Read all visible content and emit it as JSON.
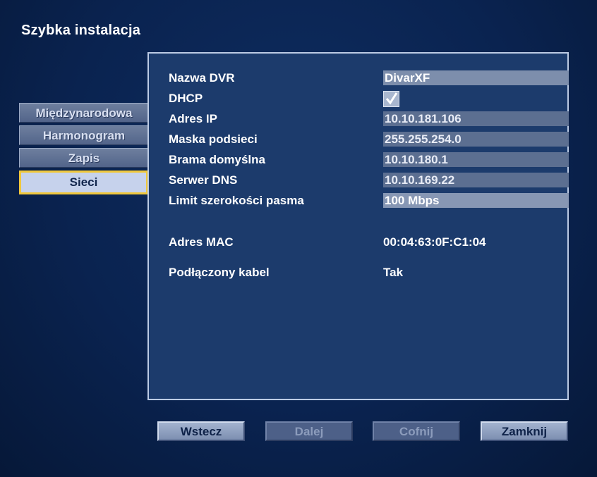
{
  "window": {
    "title": "Szybka instalacja"
  },
  "sidebar": {
    "items": [
      {
        "label": "Międzynarodowa"
      },
      {
        "label": "Harmonogram"
      },
      {
        "label": "Zapis"
      },
      {
        "label": "Sieci",
        "selected": true
      }
    ]
  },
  "network": {
    "dvr_name": {
      "label": "Nazwa DVR",
      "value": "DivarXF"
    },
    "dhcp": {
      "label": "DHCP",
      "checked": true
    },
    "ip_address": {
      "label": "Adres IP",
      "value": "10.10.181.106"
    },
    "subnet_mask": {
      "label": "Maska podsieci",
      "value": "255.255.254.0"
    },
    "gateway": {
      "label": "Brama domyślna",
      "value": "10.10.180.1"
    },
    "dns_server": {
      "label": "Serwer DNS",
      "value": "10.10.169.22"
    },
    "bandwidth_limit": {
      "label": "Limit szerokości pasma",
      "value": "100 Mbps"
    },
    "mac_address": {
      "label": "Adres MAC",
      "value": "00:04:63:0F:C1:04"
    },
    "cable_connected": {
      "label": "Podłączony kabel",
      "value": "Tak"
    }
  },
  "buttons": {
    "back": "Wstecz",
    "next": "Dalej",
    "undo": "Cofnij",
    "close": "Zamknij"
  },
  "colors": {
    "background": "#0a2350",
    "panel": "#1c3b6c",
    "selected_border": "#f0c83c"
  }
}
